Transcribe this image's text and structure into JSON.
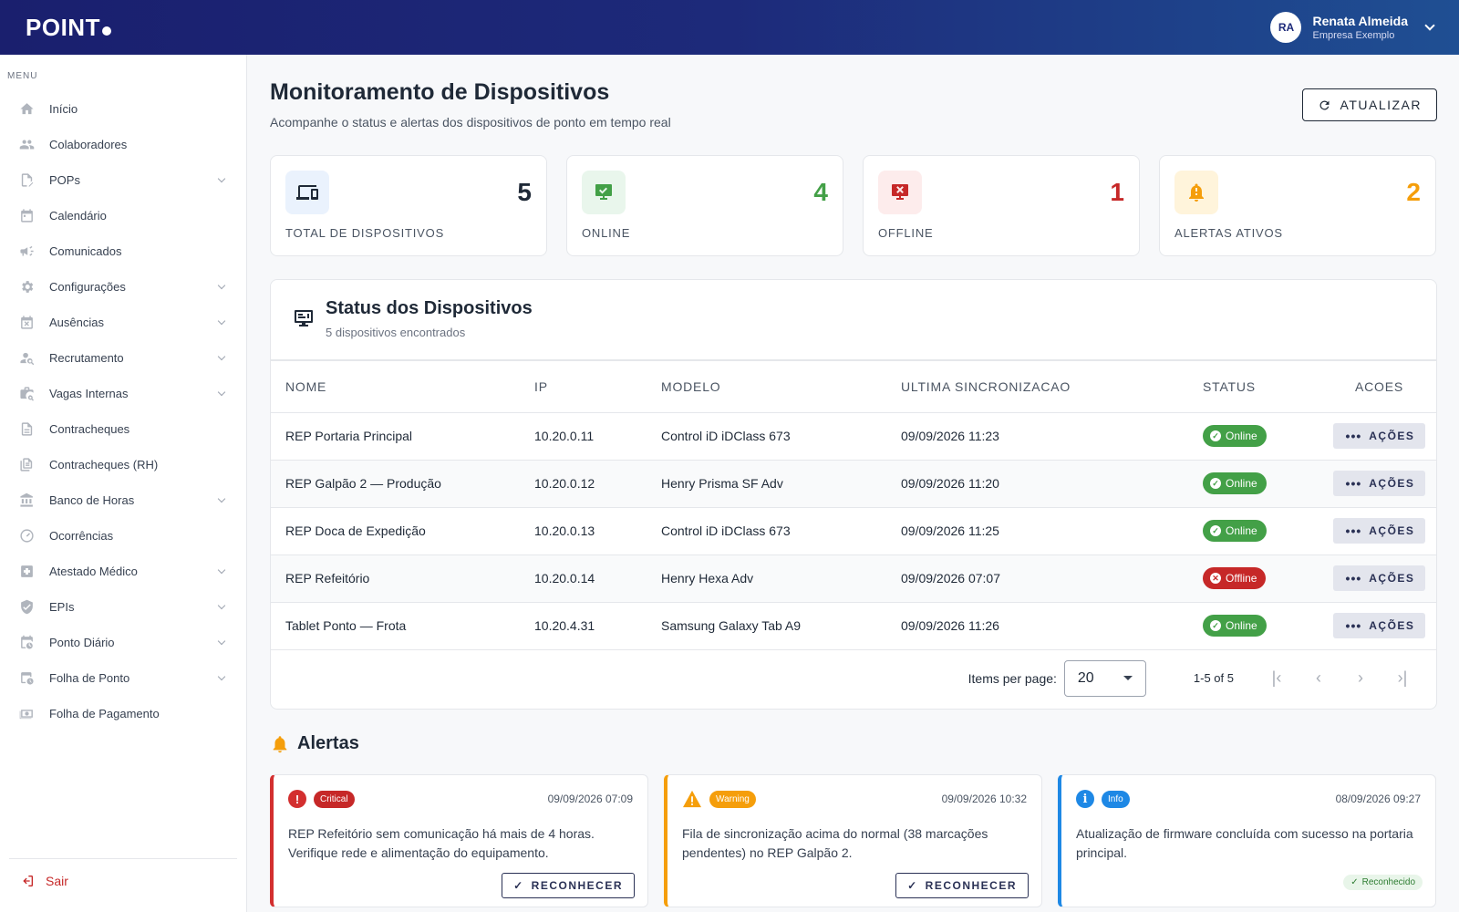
{
  "header": {
    "logo": "POINT",
    "user": {
      "initials": "RA",
      "name": "Renata Almeida",
      "company": "Empresa Exemplo"
    }
  },
  "sidebar": {
    "menu_title": "MENU",
    "items": [
      {
        "label": "Início",
        "icon": "home-icon",
        "has_children": false
      },
      {
        "label": "Colaboradores",
        "icon": "people-icon",
        "has_children": false
      },
      {
        "label": "POPs",
        "icon": "document-edit-icon",
        "has_children": true
      },
      {
        "label": "Calendário",
        "icon": "calendar-icon",
        "has_children": false
      },
      {
        "label": "Comunicados",
        "icon": "megaphone-icon",
        "has_children": false
      },
      {
        "label": "Configurações",
        "icon": "gear-icon",
        "has_children": true
      },
      {
        "label": "Ausências",
        "icon": "calendar-x-icon",
        "has_children": true
      },
      {
        "label": "Recrutamento",
        "icon": "person-search-icon",
        "has_children": true
      },
      {
        "label": "Vagas Internas",
        "icon": "briefcase-search-icon",
        "has_children": true
      },
      {
        "label": "Contracheques",
        "icon": "receipt-icon",
        "has_children": false
      },
      {
        "label": "Contracheques (RH)",
        "icon": "receipt-multiple-icon",
        "has_children": false
      },
      {
        "label": "Banco de Horas",
        "icon": "bank-icon",
        "has_children": true
      },
      {
        "label": "Ocorrências",
        "icon": "gauge-icon",
        "has_children": false
      },
      {
        "label": "Atestado Médico",
        "icon": "medical-plus-icon",
        "has_children": true
      },
      {
        "label": "EPIs",
        "icon": "shield-check-icon",
        "has_children": true
      },
      {
        "label": "Ponto Diário",
        "icon": "calendar-clock-icon",
        "has_children": true
      },
      {
        "label": "Folha de Ponto",
        "icon": "sheet-clock-icon",
        "has_children": true
      },
      {
        "label": "Folha de Pagamento",
        "icon": "cash-icon",
        "has_children": false
      }
    ],
    "logout_label": "Sair"
  },
  "page": {
    "title": "Monitoramento de Dispositivos",
    "subtitle": "Acompanhe o status e alertas dos dispositivos de ponto em tempo real",
    "refresh_label": "ATUALIZAR"
  },
  "stats": [
    {
      "value": "5",
      "label": "TOTAL DE DISPOSITIVOS",
      "color": "#1f2937",
      "bg": "#eaf2fd",
      "icon": "devices-icon"
    },
    {
      "value": "4",
      "label": "ONLINE",
      "color": "#43a047",
      "bg": "#e9f6ec",
      "icon": "device-online-icon"
    },
    {
      "value": "1",
      "label": "OFFLINE",
      "color": "#c62828",
      "bg": "#fdecec",
      "icon": "device-offline-icon"
    },
    {
      "value": "2",
      "label": "ALERTAS ATIVOS",
      "color": "#f59e0b",
      "bg": "#fff4db",
      "icon": "bell-alert-icon"
    }
  ],
  "devices": {
    "title": "Status dos Dispositivos",
    "count_text": "5 dispositivos encontrados",
    "columns": [
      "NOME",
      "IP",
      "MODELO",
      "ULTIMA SINCRONIZACAO",
      "STATUS",
      "ACOES"
    ],
    "action_label": "AÇÕES",
    "rows": [
      {
        "name": "REP Portaria Principal",
        "ip": "10.20.0.11",
        "model": "Control iD iDClass 673",
        "sync": "09/09/2026 11:23",
        "status": "Online"
      },
      {
        "name": "REP Galpão 2 — Produção",
        "ip": "10.20.0.12",
        "model": "Henry Prisma SF Adv",
        "sync": "09/09/2026 11:20",
        "status": "Online"
      },
      {
        "name": "REP Doca de Expedição",
        "ip": "10.20.0.13",
        "model": "Control iD iDClass 673",
        "sync": "09/09/2026 11:25",
        "status": "Online"
      },
      {
        "name": "REP Refeitório",
        "ip": "10.20.0.14",
        "model": "Henry Hexa Adv",
        "sync": "09/09/2026 07:07",
        "status": "Offline"
      },
      {
        "name": "Tablet Ponto — Frota",
        "ip": "10.20.4.31",
        "model": "Samsung Galaxy Tab A9",
        "sync": "09/09/2026 11:26",
        "status": "Online"
      }
    ],
    "pagination": {
      "items_per_page_label": "Items per page:",
      "items_per_page": "20",
      "range": "1-5 of 5"
    }
  },
  "alerts": {
    "title": "Alertas",
    "ack_label": "RECONHECER",
    "items": [
      {
        "severity": "critical",
        "badge": "Critical",
        "date": "09/09/2026 07:09",
        "message": "REP Refeitório sem comunicação há mais de 4 horas. Verifique rede e alimentação do equipamento.",
        "acknowledged": false
      },
      {
        "severity": "warning",
        "badge": "Warning",
        "date": "09/09/2026 10:32",
        "message": "Fila de sincronização acima do normal (38 marcações pendentes) no REP Galpão 2.",
        "acknowledged": false
      },
      {
        "severity": "info",
        "badge": "Info",
        "date": "08/09/2026 09:27",
        "message": "Atualização de firmware concluída com sucesso na portaria principal.",
        "acknowledged": true,
        "ack_text": "Reconhecido"
      }
    ]
  }
}
